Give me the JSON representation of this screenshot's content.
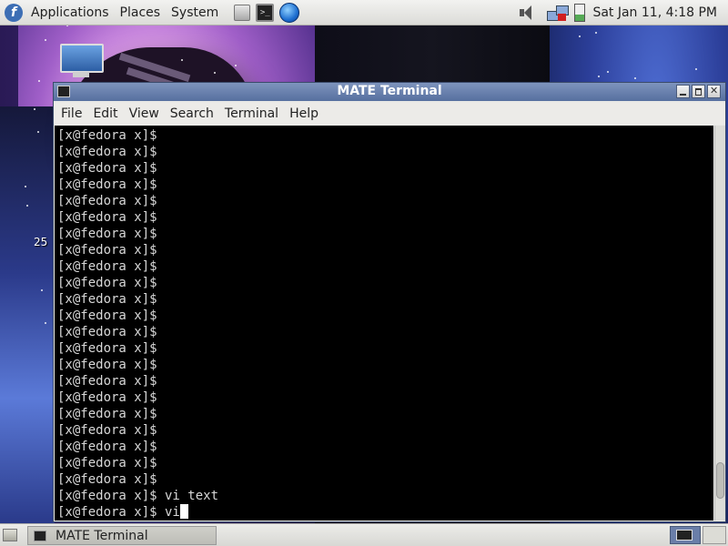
{
  "top_panel": {
    "menus": [
      "Applications",
      "Places",
      "System"
    ],
    "launchers": [
      "files-icon",
      "terminal-icon",
      "browser-icon"
    ],
    "tray_icons": [
      "volume-icon",
      "network-icon",
      "battery-icon"
    ],
    "clock": "Sat Jan 11,  4:18 PM"
  },
  "desktop": {
    "icon": "computer-icon",
    "label_25": "25"
  },
  "window": {
    "title": "MATE Terminal",
    "menu": [
      "File",
      "Edit",
      "View",
      "Search",
      "Terminal",
      "Help"
    ],
    "lines": [
      "[x@fedora x]$",
      "[x@fedora x]$",
      "[x@fedora x]$",
      "[x@fedora x]$",
      "[x@fedora x]$",
      "[x@fedora x]$",
      "[x@fedora x]$",
      "[x@fedora x]$",
      "[x@fedora x]$",
      "[x@fedora x]$",
      "[x@fedora x]$",
      "[x@fedora x]$",
      "[x@fedora x]$",
      "[x@fedora x]$",
      "[x@fedora x]$",
      "[x@fedora x]$",
      "[x@fedora x]$",
      "[x@fedora x]$",
      "[x@fedora x]$",
      "[x@fedora x]$",
      "[x@fedora x]$",
      "[x@fedora x]$",
      "[x@fedora x]$ vi text",
      "[x@fedora x]$ vi"
    ]
  },
  "bottom_panel": {
    "task_label": "MATE Terminal"
  },
  "colors": {
    "titlebar": "#566f9f",
    "terminal_bg": "#000000",
    "terminal_fg": "#d8d8d8"
  }
}
